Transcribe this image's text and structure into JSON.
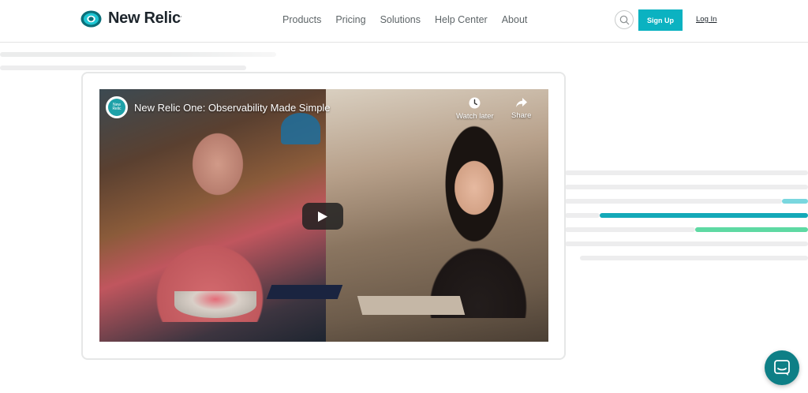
{
  "brand": {
    "name": "New Relic",
    "mark": "."
  },
  "nav": {
    "items": [
      {
        "label": "Products"
      },
      {
        "label": "Pricing"
      },
      {
        "label": "Solutions"
      },
      {
        "label": "Help Center"
      },
      {
        "label": "About"
      }
    ]
  },
  "header_actions": {
    "search_icon": "search-icon",
    "signup_label": "Sign Up",
    "login_label": "Log In"
  },
  "video": {
    "channel_avatar_text": "New Relic",
    "title": "New Relic One: Observability Made Simple",
    "watch_later_label": "Watch later",
    "share_label": "Share",
    "play_icon": "play-icon"
  },
  "chat": {
    "icon": "chat-icon"
  },
  "colors": {
    "accent": "#0bb2c1",
    "teal": "#14a9b8",
    "green": "#5ed9a3",
    "light_teal": "#7ad7df",
    "gray_line": "#eceded",
    "chat_bg": "#0e7f86"
  }
}
